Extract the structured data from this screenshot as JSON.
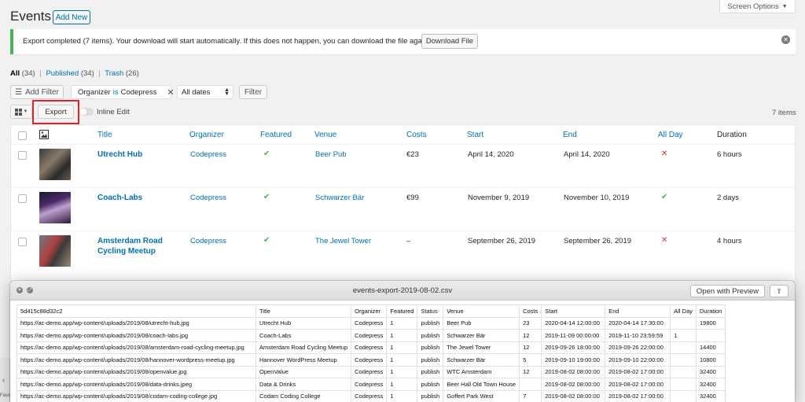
{
  "page": {
    "title": "Events",
    "add_new": "Add New",
    "screen_options": "Screen Options"
  },
  "notice": {
    "text": "Export completed (7 items). Your download will start automatically. If this does not happen, you can download the file again:",
    "button": "Download File",
    "accent": "#46b450"
  },
  "views": {
    "all": "All",
    "all_count": "(34)",
    "published": "Published",
    "published_count": "(34)",
    "trash": "Trash",
    "trash_count": "(26)",
    "sep": "|"
  },
  "filters": {
    "add_filter": "Add Filter",
    "organizer_label": "Organizer",
    "organizer_op": "is",
    "organizer_value": "Codepress",
    "dates": "All dates",
    "filter_button": "Filter"
  },
  "toolbar": {
    "export": "Export",
    "inline_edit": "Inline Edit",
    "item_count": "7 items"
  },
  "table": {
    "columns": [
      "Title",
      "Organizer",
      "Featured",
      "Venue",
      "Costs",
      "Start",
      "End",
      "All Day",
      "Duration"
    ],
    "rows": [
      {
        "title": "Utrecht Hub",
        "organizer": "Codepress",
        "featured": "✔",
        "venue": "Beer Pub",
        "costs": "€23",
        "start": "April 14, 2020",
        "end": "April 14, 2020",
        "allday": "✕",
        "duration": "6 hours"
      },
      {
        "title": "Coach-Labs",
        "organizer": "Codepress",
        "featured": "✔",
        "venue": "Schwarzer Bär",
        "costs": "€99",
        "start": "November 9, 2019",
        "end": "November 10, 2019",
        "allday": "✔",
        "duration": "2 days"
      },
      {
        "title": "Amsterdam Road Cycling Meetup",
        "organizer": "Codepress",
        "featured": "✔",
        "venue": "The Jewel Tower",
        "costs": "–",
        "start": "September 26, 2019",
        "end": "September 26, 2019",
        "allday": "✕",
        "duration": "4 hours"
      }
    ]
  },
  "quicklook": {
    "filename": "events-export-2019-08-02.csv",
    "open_with": "Open with Preview",
    "header": [
      "5d415c88d32c2",
      "Title",
      "Organizer",
      "Featured",
      "Status",
      "Venue",
      "Costs",
      "Start",
      "End",
      "All Day",
      "Duration"
    ],
    "rows": [
      [
        "https://ac-demo.app/wp-content/uploads/2019/08/utrecht-hub.jpg",
        "Utrecht Hub",
        "Codepress",
        "1",
        "publish",
        "Beer Pub",
        "23",
        "2020-04-14 12:00:00",
        "2020-04-14 17:30:00",
        "",
        "19800"
      ],
      [
        "https://ac-demo.app/wp-content/uploads/2019/08/coach-labs.jpg",
        "Coach-Labs",
        "Codepress",
        "1",
        "publish",
        "Schwarzer Bär",
        "12",
        "2019-11-09 00:00:00",
        "2019-11-10 23:59:59",
        "1",
        ""
      ],
      [
        "https://ac-demo.app/wp-content/uploads/2019/08/amsterdam-road-cycling-meetup.jpg",
        "Amsterdam Road Cycling Meetup",
        "Codepress",
        "1",
        "publish",
        "The Jewel Tower",
        "12",
        "2019-09-26 18:00:00",
        "2019-09-26 22:00:00",
        "",
        "14400"
      ],
      [
        "https://ac-demo.app/wp-content/uploads/2019/08/hannover-wordpress-meetup.jpg",
        "Hannover WordPress Meetup",
        "Codepress",
        "1",
        "publish",
        "Schwarzer Bär",
        "5",
        "2019-09-10 19:00:00",
        "2019-09-10 22:00:00",
        "",
        "10800"
      ],
      [
        "https://ac-demo.app/wp-content/uploads/2019/08/openvalue.jpg",
        "OpenValue",
        "Codepress",
        "1",
        "publish",
        "WTC Amsterdam",
        "12",
        "2019-08-02 08:00:00",
        "2019-08-02 17:00:00",
        "",
        "32400"
      ],
      [
        "https://ac-demo.app/wp-content/uploads/2019/08/data-drinks.jpeg",
        "Data & Drinks",
        "Codepress",
        "1",
        "publish",
        "Beer Hall Old Town House",
        "",
        "2019-08-02 08:00:00",
        "2019-08-02 17:00:00",
        "",
        "32400"
      ],
      [
        "https://ac-demo.app/wp-content/uploads/2019/08/codam-coding-college.jpg",
        "Codam Coding College",
        "Codepress",
        "1",
        "publish",
        "Goffert Park West",
        "7",
        "2019-08-02 08:00:00",
        "2019-08-02 17:00:00",
        "",
        "32400"
      ]
    ]
  },
  "sidebar": {
    "chevron": "‹",
    "fav": "Favo"
  }
}
